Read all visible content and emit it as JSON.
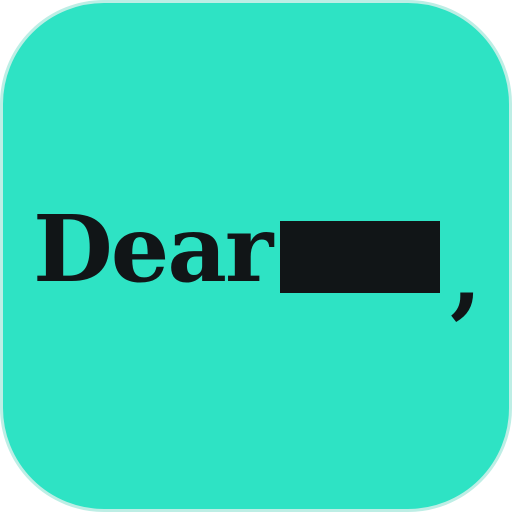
{
  "icon": {
    "background_color": "#2ee3c4",
    "greeting": "Dear",
    "punctuation": ",",
    "redaction_color": "#111517"
  }
}
